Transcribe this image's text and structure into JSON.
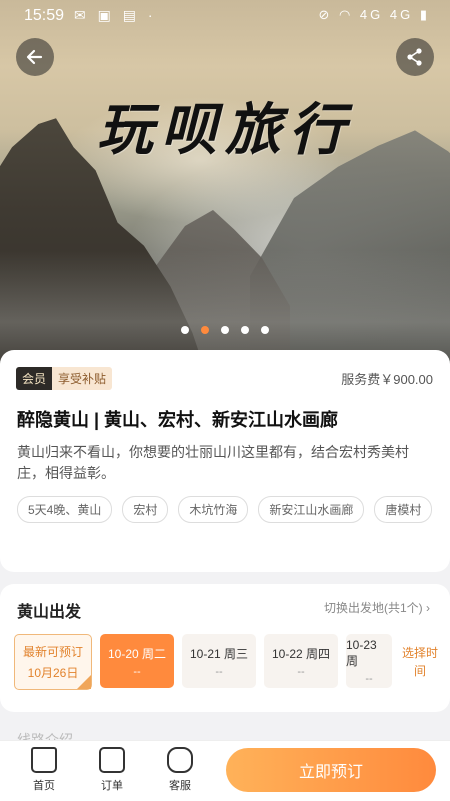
{
  "status_bar": {
    "time": "15:59",
    "left_icons": "✉ ▣ ▤ ·",
    "right_icons": "⊘ ◠ 4G 4G ▮"
  },
  "hero": {
    "title": "玩呗旅行",
    "dots": [
      false,
      true,
      false,
      false,
      false
    ]
  },
  "member": {
    "badge": "会员",
    "subsidy": "享受补贴",
    "service_fee": "服务费￥900.00"
  },
  "product": {
    "title": "醉隐黄山 | 黄山、宏村、新安江山水画廊",
    "description": "黄山归来不看山，你想要的壮丽山川这里都有，结合宏村秀美村庄，相得益彰。",
    "tags": [
      "5天4晚、黄山",
      "宏村",
      "木坑竹海",
      "新安江山水画廊",
      "唐模村"
    ]
  },
  "departure": {
    "title": "黄山出发",
    "switch_label": "切换出发地(共1个)",
    "first_date": {
      "line1": "最新可预订",
      "line2": "10月26日"
    },
    "dates": [
      {
        "label": "10-20 周二",
        "sub": "--"
      },
      {
        "label": "10-21 周三",
        "sub": "--"
      },
      {
        "label": "10-22 周四",
        "sub": "--"
      },
      {
        "label": "10-23 周",
        "sub": "--"
      }
    ],
    "select_time": "选择时间"
  },
  "bottom_nav": {
    "home": "首页",
    "orders": "订单",
    "service": "客服",
    "order_button": "立即预订"
  },
  "peek": "线路介绍",
  "colors": {
    "accent": "#ff8a3d",
    "member_dark": "#2d2a27"
  }
}
